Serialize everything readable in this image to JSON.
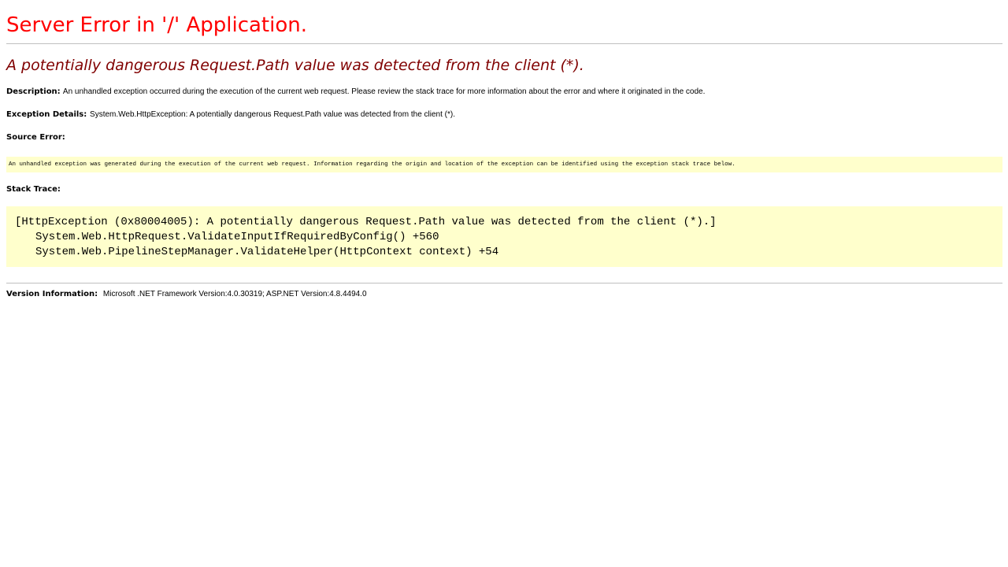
{
  "page": {
    "app_title": "Server Error in '/' Application.",
    "error_heading": "A potentially dangerous Request.Path value was detected from the client (*).",
    "description": {
      "label": "Description:",
      "text": "An unhandled exception occurred during the execution of the current web request. Please review the stack trace for more information about the error and where it originated in the code."
    },
    "exception_details": {
      "label": "Exception Details:",
      "text": "System.Web.HttpException: A potentially dangerous Request.Path value was detected from the client (*)."
    },
    "source_error": {
      "label": "Source Error:",
      "text": "An unhandled exception was generated during the execution of the current web request. Information regarding the origin and location of the exception can be identified using the exception stack trace below."
    },
    "stack_trace": {
      "label": "Stack Trace:",
      "lines": [
        "[HttpException (0x80004005): A potentially dangerous Request.Path value was detected from the client (*).]",
        "System.Web.HttpRequest.ValidateInputIfRequiredByConfig() +560",
        "System.Web.PipelineStepManager.ValidateHelper(HttpContext context) +54"
      ]
    },
    "version_info": {
      "label": "Version Information:",
      "text": "Microsoft .NET Framework Version:4.0.30319; ASP.NET Version:4.8.4494.0"
    }
  },
  "colors": {
    "title": "#ff0000",
    "heading": "#800000",
    "code_background": "#ffffcc",
    "rule": "#c0c0c0"
  }
}
